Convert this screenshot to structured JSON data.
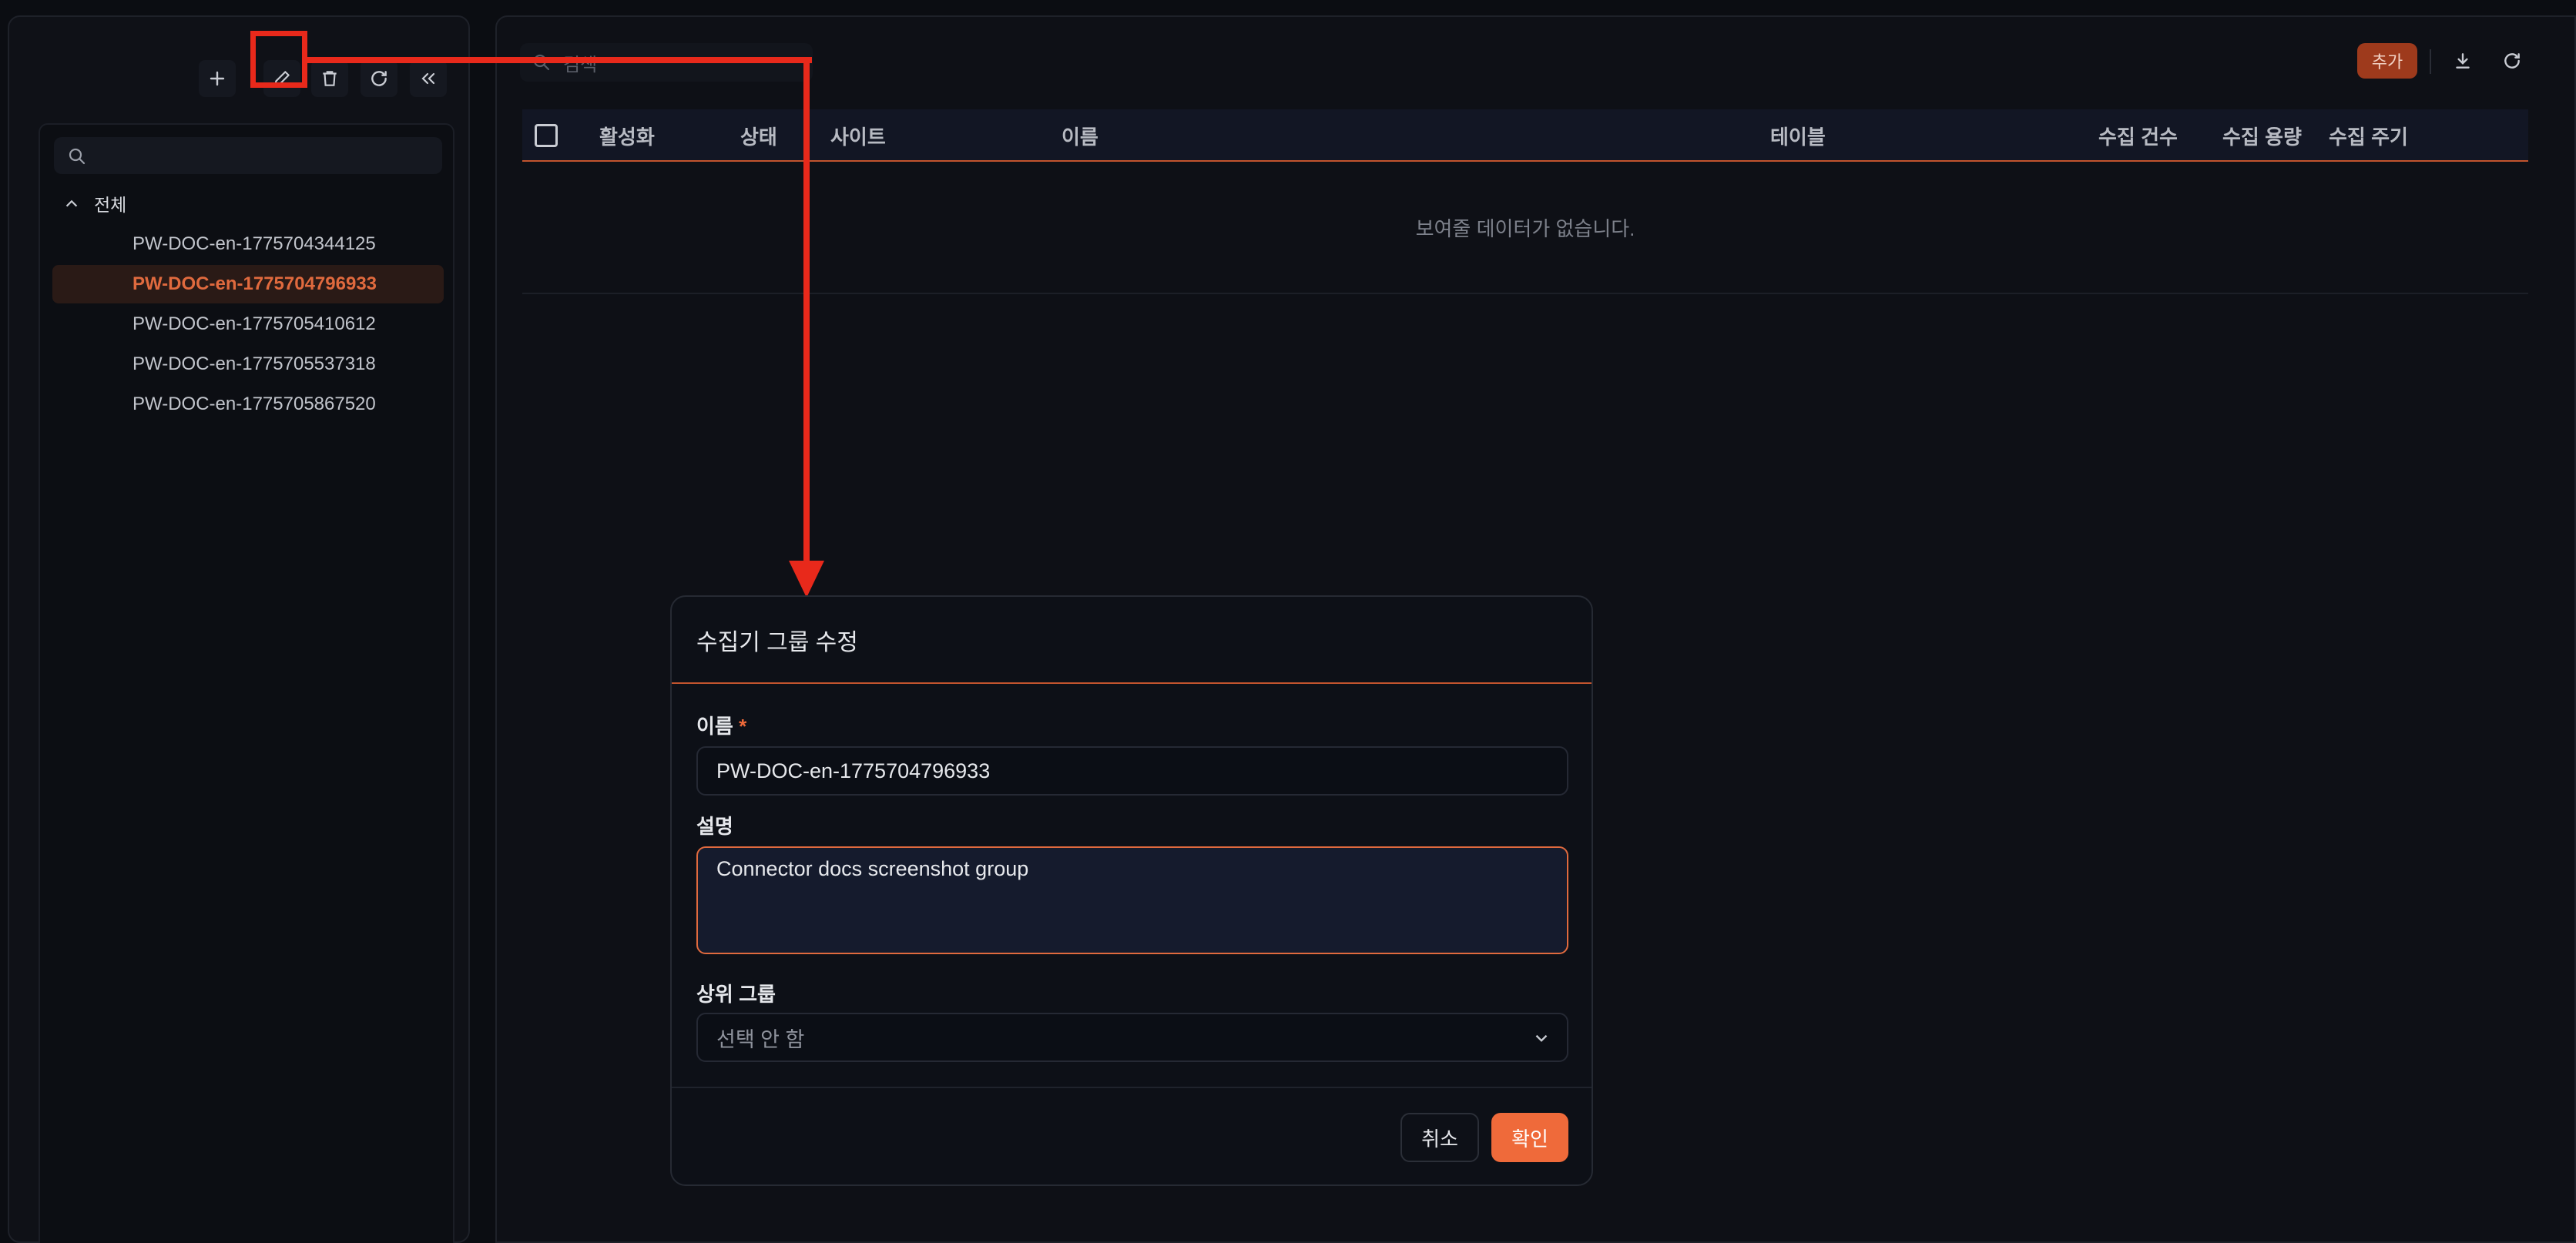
{
  "sidebar": {
    "search": {
      "placeholder": ""
    },
    "root_label": "전체",
    "items": [
      {
        "label": "PW-DOC-en-1775704344125",
        "selected": false
      },
      {
        "label": "PW-DOC-en-1775704796933",
        "selected": true
      },
      {
        "label": "PW-DOC-en-1775705410612",
        "selected": false
      },
      {
        "label": "PW-DOC-en-1775705537318",
        "selected": false
      },
      {
        "label": "PW-DOC-en-1775705867520",
        "selected": false
      }
    ],
    "toolbar_icons": [
      "plus-icon",
      "pencil-icon",
      "trash-icon",
      "refresh-icon",
      "collapse-icon"
    ]
  },
  "main": {
    "search": {
      "placeholder": "검색"
    },
    "add_label": "추가",
    "table": {
      "columns": [
        "활성화",
        "상태",
        "사이트",
        "이름",
        "테이블",
        "수집 건수",
        "수집 용량",
        "수집 주기"
      ],
      "empty_text": "보여줄 데이터가 없습니다."
    }
  },
  "modal": {
    "title": "수집기 그룹 수정",
    "name_label": "이름",
    "required_mark": "*",
    "name_value": "PW-DOC-en-1775704796933",
    "desc_label": "설명",
    "desc_value": "Connector docs screenshot group",
    "parent_label": "상위 그룹",
    "parent_value": "선택 안 함",
    "cancel_label": "취소",
    "ok_label": "확인"
  },
  "colors": {
    "accent": "#ef6a3a",
    "annotation": "#e8291b",
    "background": "#0b0d12"
  }
}
